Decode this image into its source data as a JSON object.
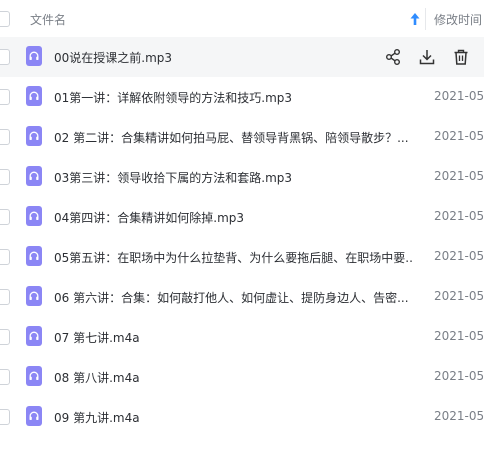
{
  "header": {
    "name_col": "文件名",
    "mtime_col": "修改时间"
  },
  "icons": {
    "file": "headphones-audio-icon",
    "share": "share-icon",
    "download": "download-icon",
    "delete": "trash-icon",
    "sort": "sort-ascending-arrow-icon"
  },
  "colors": {
    "audio_icon": "#8b86f5",
    "sort_arrow": "#2f8cff"
  },
  "files": [
    {
      "name": "00说在授课之前.mp3",
      "date": ""
    },
    {
      "name": "01第一讲：详解依附领导的方法和技巧.mp3",
      "date": "2021-05-"
    },
    {
      "name": "02 第二讲：合集精讲如何拍马屁、替领导背黑锅、陪领导散步？...",
      "date": "2021-05-"
    },
    {
      "name": "03第三讲：领导收拾下属的方法和套路.mp3",
      "date": "2021-05-"
    },
    {
      "name": "04第四讲：合集精讲如何除掉.mp3",
      "date": "2021-05-"
    },
    {
      "name": "05第五讲：在职场中为什么拉垫背、为什么要拖后腿、在职场中要...",
      "date": "2021-05-"
    },
    {
      "name": "06 第六讲：合集：如何敲打他人、如何虚让、提防身边人、告密...",
      "date": "2021-05-"
    },
    {
      "name": "07 第七讲.m4a",
      "date": "2021-05-"
    },
    {
      "name": "08 第八讲.m4a",
      "date": "2021-05-"
    },
    {
      "name": "09 第九讲.m4a",
      "date": "2021-05-"
    }
  ]
}
